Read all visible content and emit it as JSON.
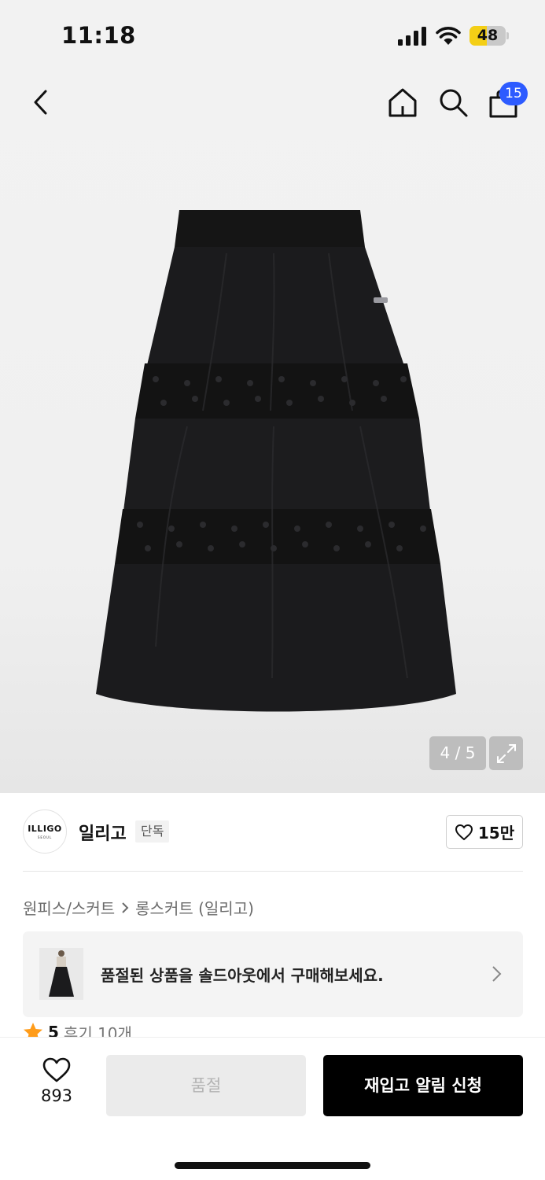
{
  "status_bar": {
    "time": "11:18",
    "battery": "48",
    "battery_level": 0.48,
    "battery_color": "#f4cf16"
  },
  "header": {
    "back_icon": "chevron-left-icon",
    "home_icon": "home-icon",
    "search_icon": "search-icon",
    "bag_icon": "shopping-bag-icon",
    "bag_badge": "15",
    "badge_color": "#2d5bff"
  },
  "gallery": {
    "counter": "4 / 5",
    "expand_icon": "expand-icon"
  },
  "brand": {
    "logo_text": "ILLIGO",
    "logo_subtext": "SEOUL",
    "name": "일리고",
    "tag": "단독",
    "like_count": "15만"
  },
  "breadcrumb": {
    "category": "원피스/스커트",
    "subcategory": "롱스커트 (일리고)"
  },
  "soldout_banner": {
    "text": "품절된 상품을 솔드아웃에서 구매해보세요."
  },
  "rating": {
    "score": "5",
    "reviews": "후기 10개",
    "star_color": "#ff9c1a"
  },
  "bottom_bar": {
    "like_count": "893",
    "soldout_label": "품절",
    "restock_label": "재입고 알림 신청"
  }
}
